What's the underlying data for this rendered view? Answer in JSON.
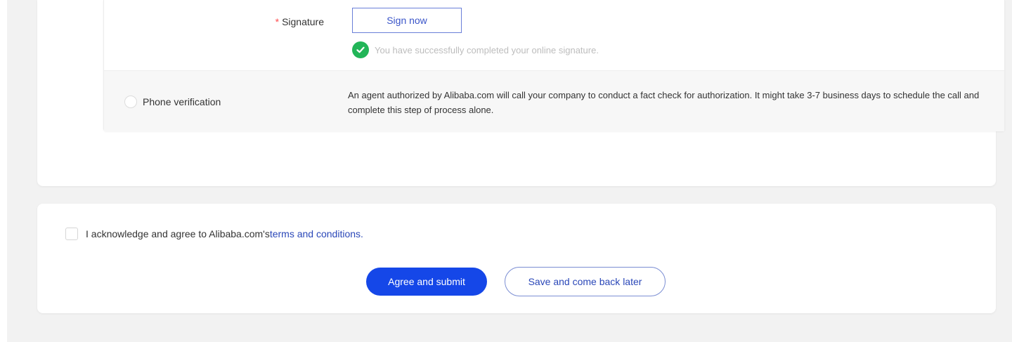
{
  "signature": {
    "required_mark": "*",
    "label": "Signature",
    "sign_button_label": "Sign now",
    "success_icon": "check-circle-icon",
    "success_message": "You have successfully completed your online signature."
  },
  "phone_verification": {
    "label": "Phone verification",
    "description": "An agent authorized by Alibaba.com will call your company to conduct a fact check for authorization. It might take 3-7 business days to schedule the call and complete this step of process alone."
  },
  "acknowledgement": {
    "text": "I acknowledge and agree to Alibaba.com's ",
    "link_text": "terms and conditions."
  },
  "actions": {
    "agree_label": "Agree and submit",
    "save_label": "Save and come back later"
  },
  "colors": {
    "primary": "#1547e8",
    "link": "#2a47b8",
    "success": "#22b558",
    "required": "#ff4d4f"
  }
}
